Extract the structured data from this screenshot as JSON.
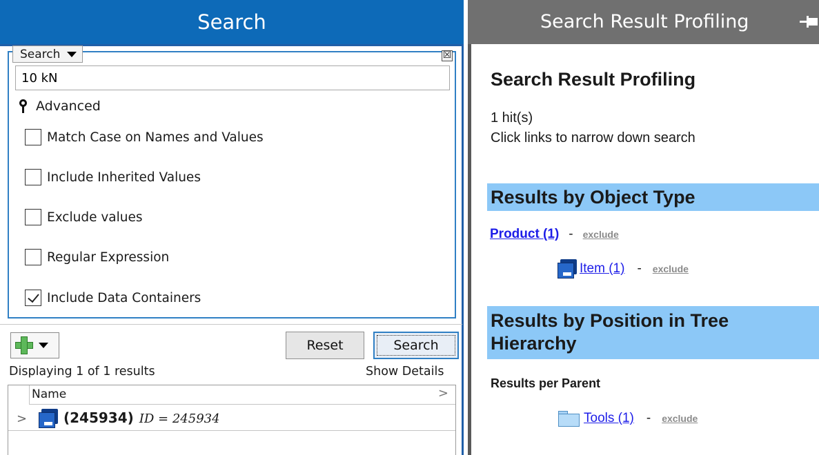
{
  "search_panel": {
    "title": "Search",
    "search_type": "Search",
    "clear_glyph": "☒",
    "query_value": "10 kN",
    "advanced_label": "Advanced",
    "options": [
      {
        "label": "Match Case on Names and Values",
        "checked": false
      },
      {
        "label": "Include Inherited Values",
        "checked": false
      },
      {
        "label": "Exclude values",
        "checked": false
      },
      {
        "label": "Regular Expression",
        "checked": false
      },
      {
        "label": "Include Data Containers",
        "checked": true
      }
    ],
    "reset_label": "Reset",
    "search_label": "Search",
    "results_count": "Displaying 1 of 1 results",
    "show_details": "Show Details",
    "column_header": "Name",
    "header_chevron": ">",
    "row_expander": ">",
    "result": {
      "id_bold": "(245934)",
      "id_italic": "ID = 245934"
    }
  },
  "profiling_panel": {
    "title": "Search Result Profiling",
    "heading": "Search Result Profiling",
    "hits": "1 hit(s)",
    "hint": "Click links to narrow down search",
    "section_type": "Results by Object Type",
    "product_link": "Product (1)",
    "item_link": "Item (1)",
    "section_tree": "Results by Position in Tree Hierarchy",
    "per_parent": "Results per Parent",
    "tools_link": "Tools (1)",
    "separator": "-",
    "exclude": "exclude"
  },
  "icons": {
    "title_pin": "pin-icon",
    "advanced": "map-pin-icon",
    "add": "green-plus-icon",
    "item": "blue-item-icon",
    "folder": "folder-icon"
  },
  "colors": {
    "search_header": "#0d6ab8",
    "profiling_header": "#707070",
    "section_band": "#8cc8f7",
    "link": "#1d1de8",
    "exclude_link": "#8a8a8a"
  }
}
